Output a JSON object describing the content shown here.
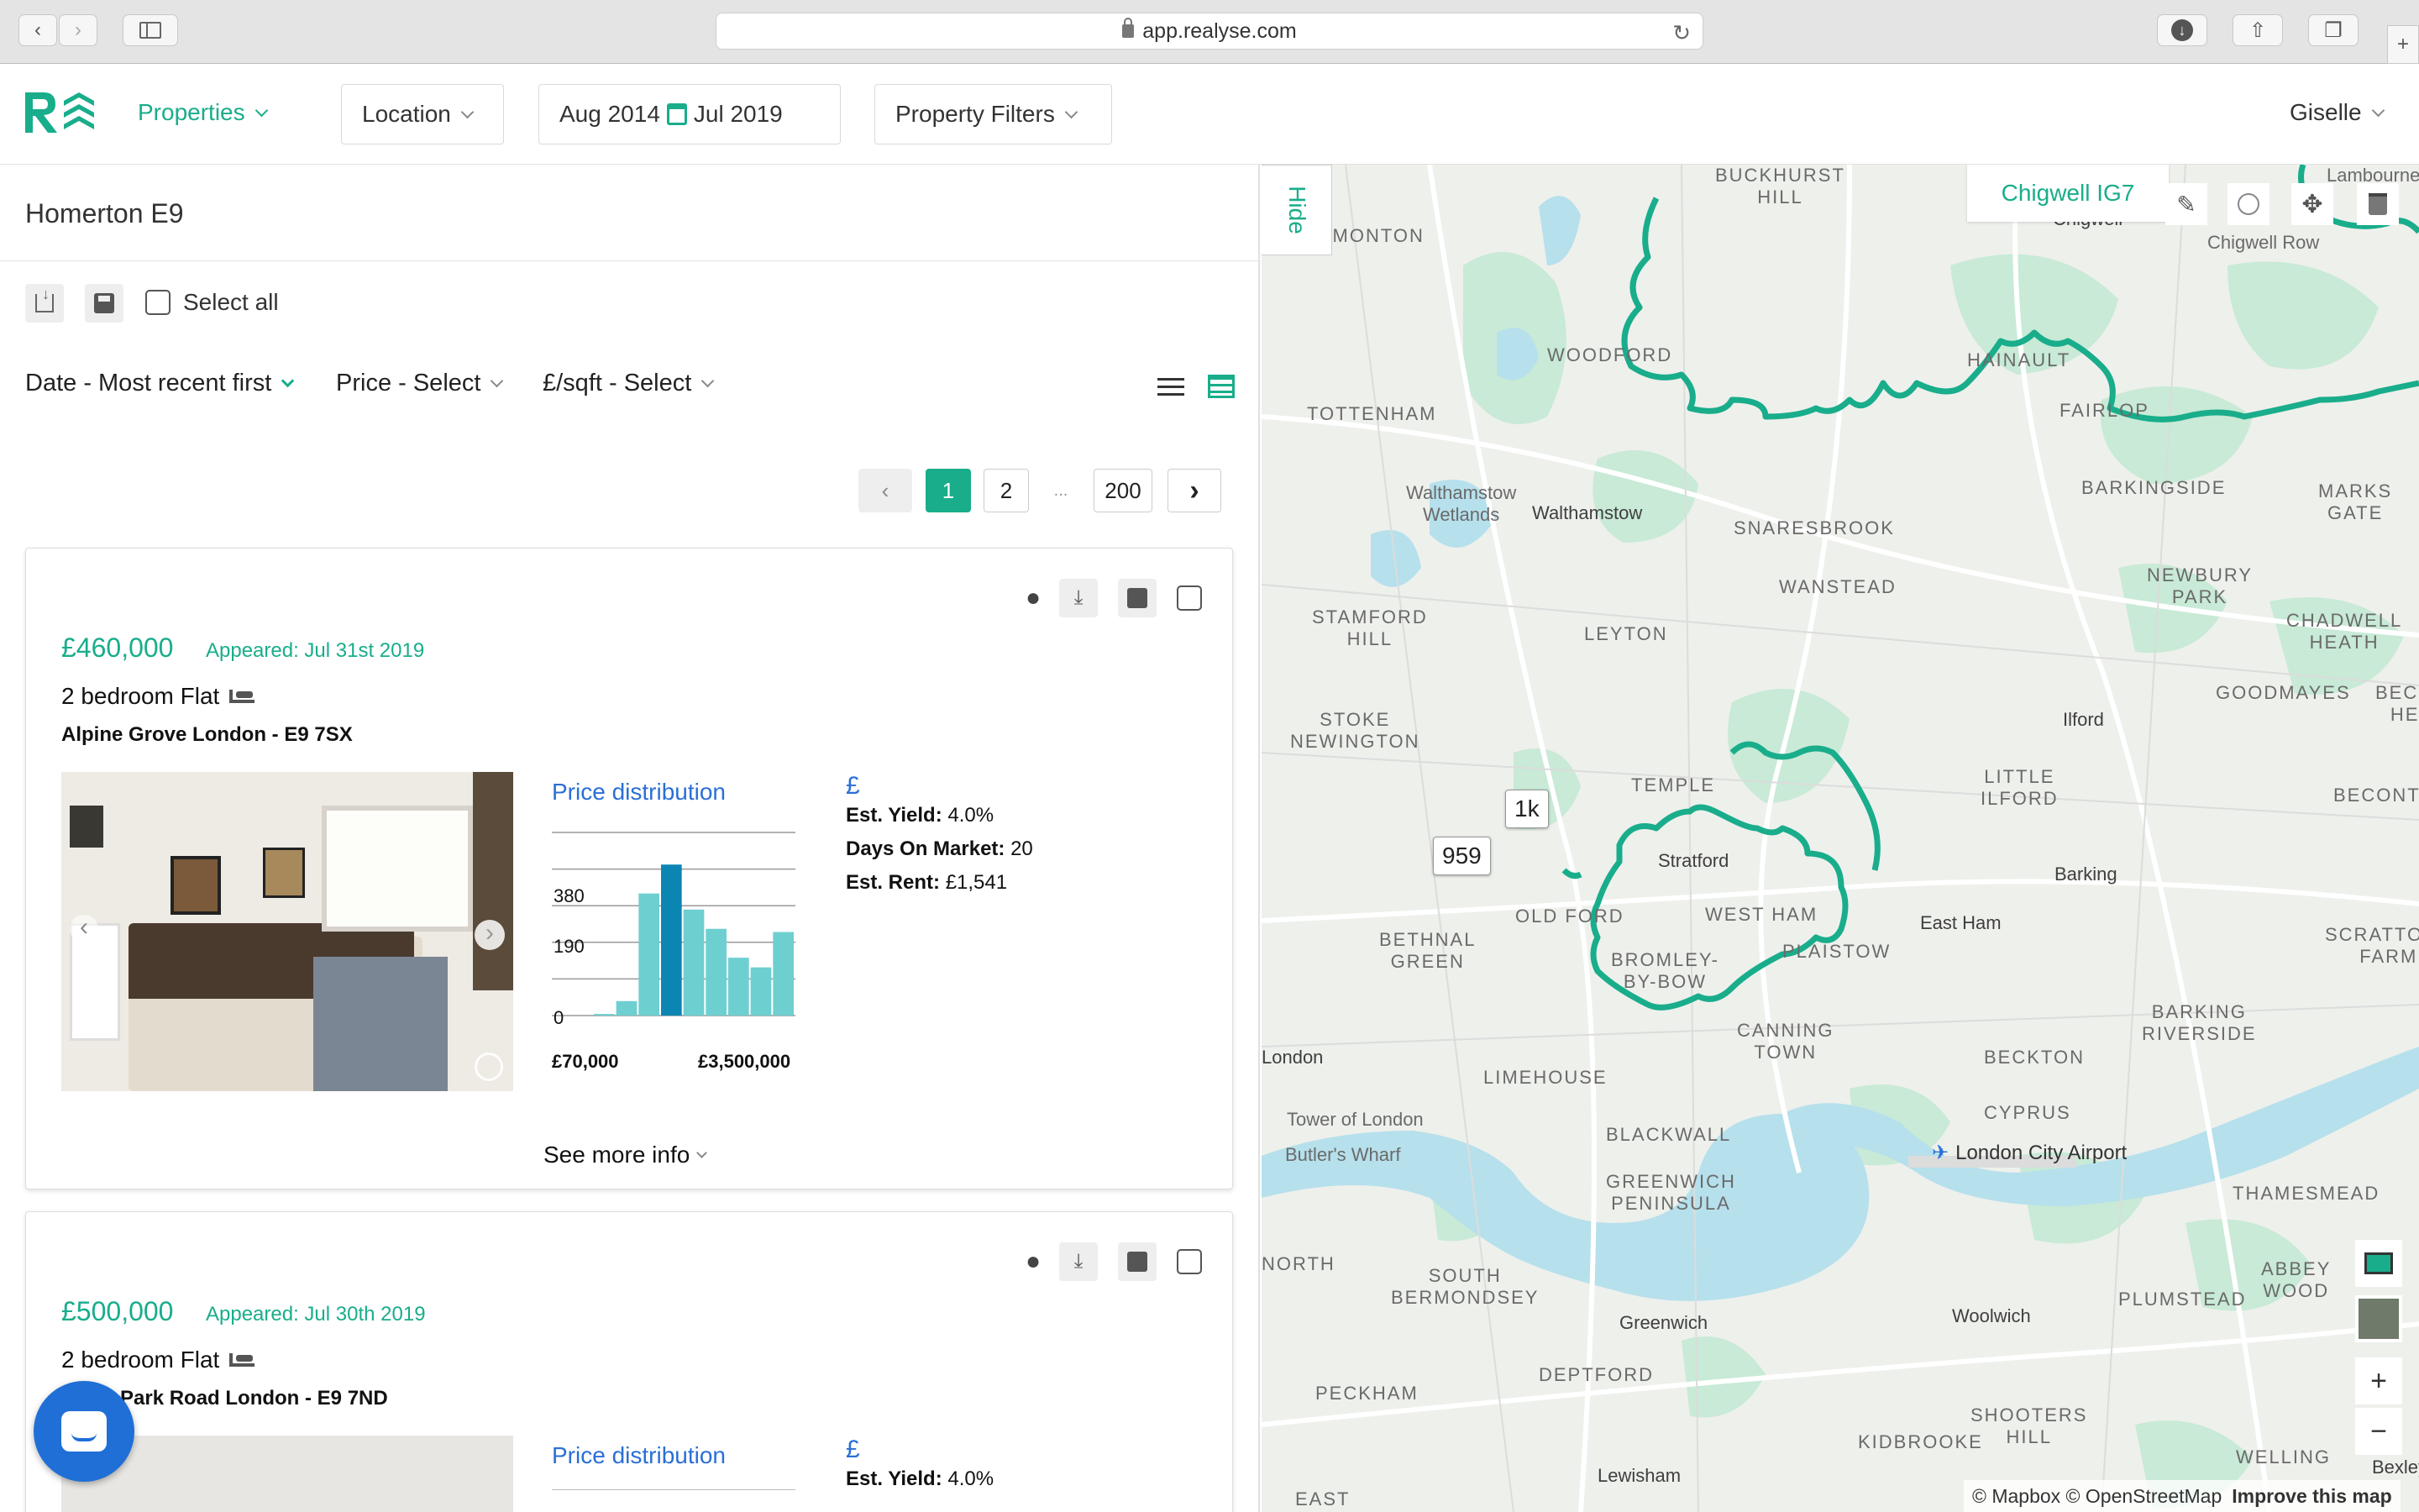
{
  "browser": {
    "url": "app.realyse.com"
  },
  "header": {
    "nav_properties": "Properties",
    "location": "Location",
    "date_from": "Aug 2014",
    "date_to": "Jul 2019",
    "filters": "Property Filters",
    "user": "Giselle"
  },
  "search": {
    "area": "Homerton E9"
  },
  "toolbar": {
    "select_all": "Select all"
  },
  "sort": {
    "date": "Date - Most recent first",
    "price": "Price - Select",
    "sqft": "£/sqft - Select"
  },
  "pagination": {
    "pages": [
      "1",
      "2",
      "...",
      "200"
    ],
    "current": "1"
  },
  "listings": [
    {
      "price": "£460,000",
      "appeared": "Appeared: Jul 31st 2019",
      "title": "2 bedroom Flat",
      "address": "Alpine Grove London - E9 7SX",
      "pd_title": "Price distribution",
      "currency": "£",
      "yield_label": "Est. Yield:",
      "yield": "4.0%",
      "dom_label": "Days On Market:",
      "dom": "20",
      "rent_label": "Est. Rent:",
      "rent": "£1,541",
      "see_more": "See more info"
    },
    {
      "price": "£500,000",
      "appeared": "Appeared: Jul 30th 2019",
      "title": "2 bedroom Flat",
      "address": "Park Road London - E9 7ND",
      "pd_title": "Price distribution",
      "currency": "£",
      "yield_label": "Est. Yield:",
      "yield": "4.0%"
    }
  ],
  "chart_data": {
    "type": "bar",
    "title": "Price distribution",
    "y_ticks": [
      "380",
      "190",
      "0"
    ],
    "x_labels": [
      "£70,000",
      "£3,500,000"
    ],
    "ylim": [
      0,
      570
    ],
    "values": [
      5,
      45,
      380,
      470,
      330,
      270,
      180,
      150,
      260
    ],
    "highlight_index": 3,
    "colors": {
      "bar": "#6ecfd0",
      "highlight": "#0b86b3"
    }
  },
  "map": {
    "hide": "Hide",
    "region_label": "Chigwell IG7",
    "markers": [
      "1k",
      "959"
    ],
    "airport": "London City Airport",
    "labels_caps": [
      "BUCKHURST HILL",
      "EDMONTON",
      "WOODFORD",
      "TOTTENHAM",
      "HAINAULT",
      "FAIRLOP",
      "BARKINGSIDE",
      "MARKS GATE",
      "SNARESBROOK",
      "WANSTEAD",
      "NEWBURY PARK",
      "CHADWELL HEATH",
      "STAMFORD HILL",
      "LEYTON",
      "GOODMAYES",
      "BECONTREE HEATH",
      "STOKE NEWINGTON",
      "LITTLE ILFORD",
      "BECONTREE",
      "TEMPLE",
      "WEST HAM",
      "OLD FORD",
      "BETHNAL GREEN",
      "BROMLEY-BY-BOW",
      "PLAISTOW",
      "SCRATTONS FARM",
      "CANNING TOWN",
      "BARKING RIVERSIDE",
      "LIMEHOUSE",
      "BECKTON",
      "CYPRUS",
      "BLACKWALL",
      "GREENWICH PENINSULA",
      "THAMESMEAD",
      "SOUTH BERMONDSEY",
      "ABBEY WOOD",
      "PLUMSTEAD",
      "DEPTFORD",
      "PECKHAM",
      "SHOOTERS HILL",
      "KIDBROOKE",
      "WELLING",
      "EAST",
      "NORTH",
      "Walthamstow Wetlands",
      "Chigwell Row",
      "Lambourne End",
      "Tower of London",
      "Butler's Wharf"
    ],
    "labels_towns": [
      "Chigwell",
      "Walthamstow",
      "Ilford",
      "Stratford",
      "Barking",
      "East Ham",
      "London",
      "Greenwich",
      "Woolwich",
      "Lewisham",
      "Bexley"
    ],
    "attribution": "© Mapbox © OpenStreetMap",
    "improve": "Improve this map",
    "zoom_in": "+",
    "zoom_out": "−"
  }
}
